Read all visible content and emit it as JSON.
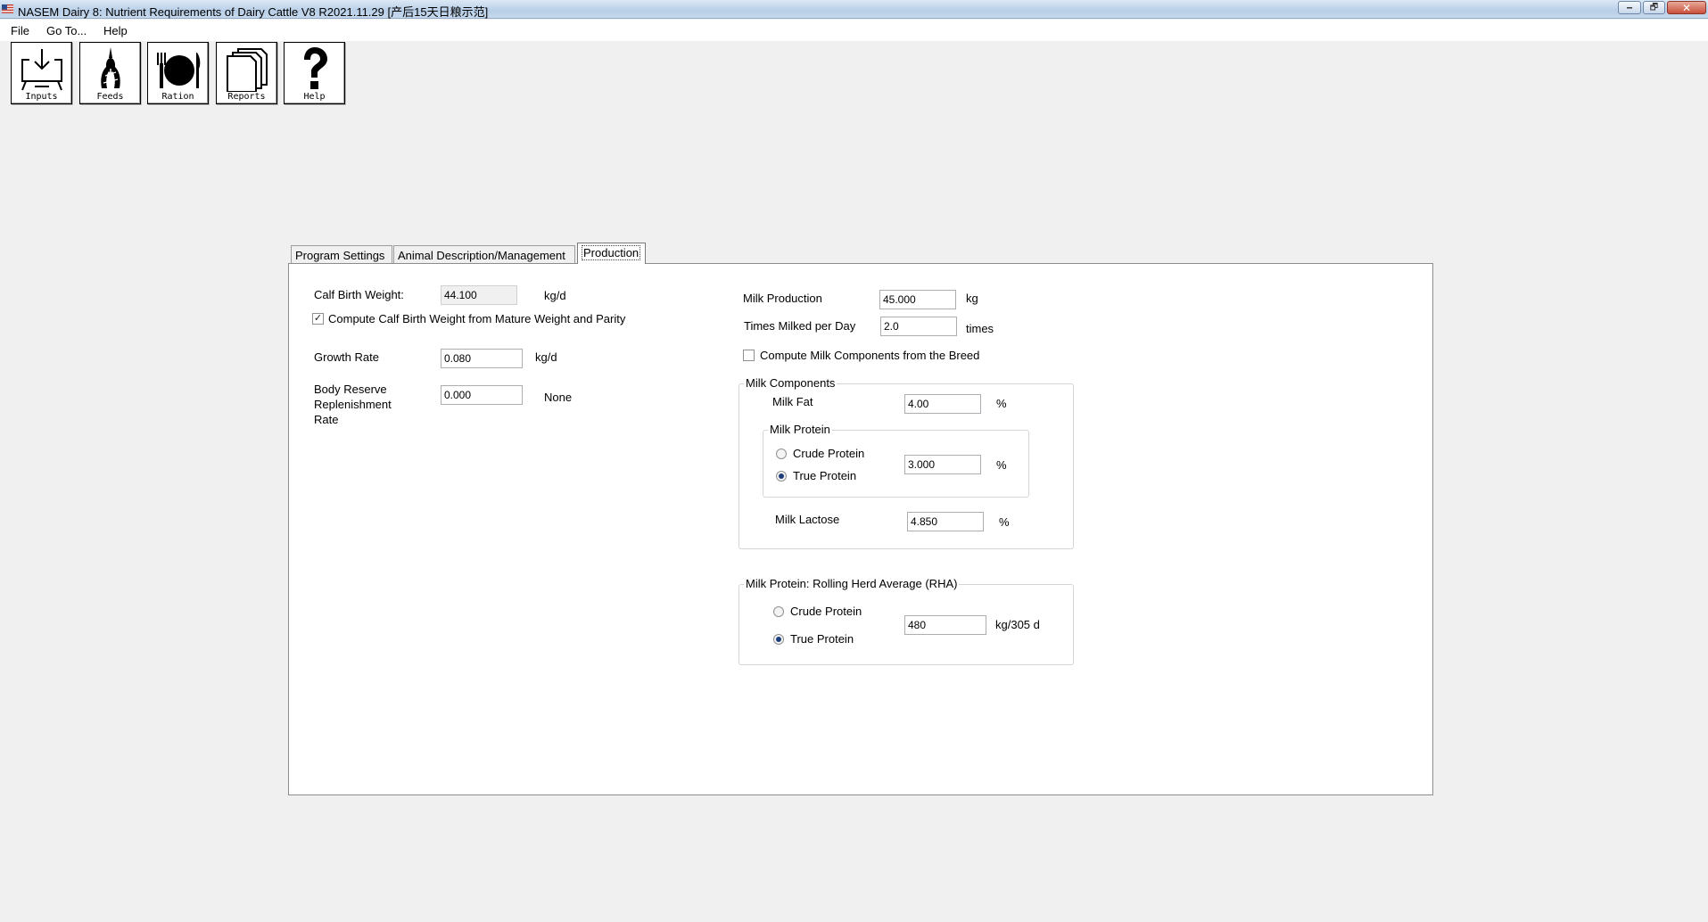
{
  "window": {
    "title": "NASEM Dairy 8: Nutrient Requirements of Dairy Cattle  V8 R2021.11.29 [产后15天日粮示范]",
    "min_glyph": "🗕",
    "max_glyph": "🗗",
    "close_glyph": "✕"
  },
  "menu": {
    "file": "File",
    "goto": "Go To...",
    "help": "Help"
  },
  "toolbar": {
    "inputs": "Inputs",
    "feeds": "Feeds",
    "ration": "Ration",
    "reports": "Reports",
    "help": "Help"
  },
  "tabs": {
    "program_settings": "Program Settings",
    "animal_description": "Animal Description/Management",
    "production": "Production"
  },
  "left": {
    "calf_birth_weight_label": "Calf Birth Weight:",
    "calf_birth_weight_value": "44.100",
    "calf_birth_weight_unit": "kg/d",
    "compute_calf_label": "Compute Calf Birth Weight from Mature Weight and Parity",
    "compute_calf_checked": true,
    "growth_rate_label": "Growth Rate",
    "growth_rate_value": "0.080",
    "growth_rate_unit": "kg/d",
    "body_reserve_line1": "Body Reserve",
    "body_reserve_line2": "Replenishment",
    "body_reserve_line3": "Rate",
    "body_reserve_value": "0.000",
    "body_reserve_unit": "None"
  },
  "right": {
    "milk_production_label": "Milk Production",
    "milk_production_value": "45.000",
    "milk_production_unit": "kg",
    "times_milked_label": "Times Milked per Day",
    "times_milked_value": "2.0",
    "times_milked_unit": "times",
    "compute_milk_label": "Compute Milk Components from the Breed",
    "compute_milk_checked": false,
    "milk_components_title": "Milk Components",
    "milk_fat_label": "Milk Fat",
    "milk_fat_value": "4.00",
    "milk_fat_unit": "%",
    "milk_protein_title": "Milk Protein",
    "crude_protein_label": "Crude Protein",
    "true_protein_label": "True Protein",
    "milk_protein_selected": "True Protein",
    "milk_protein_value": "3.000",
    "milk_protein_unit": "%",
    "milk_lactose_label": "Milk Lactose",
    "milk_lactose_value": "4.850",
    "milk_lactose_unit": "%",
    "rha_title": "Milk Protein: Rolling Herd Average (RHA)",
    "rha_crude_label": "Crude Protein",
    "rha_true_label": "True Protein",
    "rha_selected": "True Protein",
    "rha_value": "480",
    "rha_unit": "kg/305 d"
  }
}
